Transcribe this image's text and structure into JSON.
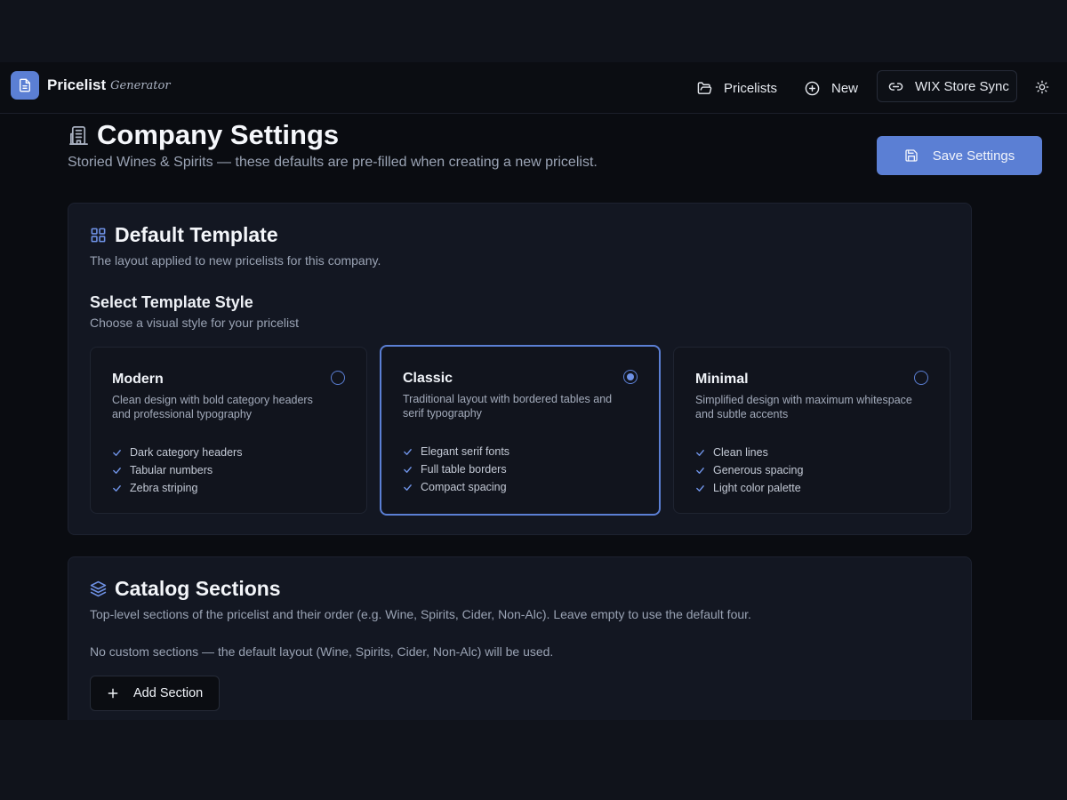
{
  "header": {
    "brand_name": "Pricelist",
    "brand_sub": "Generator",
    "nav": [
      {
        "label": "Pricelists",
        "icon": "folder-open-icon"
      },
      {
        "label": "New",
        "icon": "plus-circle-icon"
      },
      {
        "label": "WIX Store Sync",
        "icon": "link-icon"
      }
    ],
    "theme_icon": "sun-icon"
  },
  "page": {
    "title": "Company Settings",
    "subtitle": "Storied Wines & Spirits — these defaults are pre-filled when creating a new pricelist.",
    "save_label": "Save Settings"
  },
  "template_card": {
    "title": "Default Template",
    "desc": "The layout applied to new pricelists for this company.",
    "heading": "Select Template Style",
    "subheading": "Choose a visual style for your pricelist",
    "selected": "Classic",
    "options": [
      {
        "name": "Modern",
        "desc": "Clean design with bold category headers and professional typography",
        "features": [
          "Dark category headers",
          "Tabular numbers",
          "Zebra striping"
        ]
      },
      {
        "name": "Classic",
        "desc": "Traditional layout with bordered tables and serif typography",
        "features": [
          "Elegant serif fonts",
          "Full table borders",
          "Compact spacing"
        ]
      },
      {
        "name": "Minimal",
        "desc": "Simplified design with maximum whitespace and subtle accents",
        "features": [
          "Clean lines",
          "Generous spacing",
          "Light color palette"
        ]
      }
    ]
  },
  "sections_card": {
    "title": "Catalog Sections",
    "desc": "Top-level sections of the pricelist and their order (e.g. Wine, Spirits, Cider, Non-Alc). Leave empty to use the default four.",
    "empty_note": "No custom sections — the default layout (Wine, Spirits, Cider, Non-Alc) will be used.",
    "add_label": "Add Section"
  },
  "colors": {
    "accent": "#5b7fd4",
    "background": "#0a0c11",
    "card": "#131722"
  }
}
